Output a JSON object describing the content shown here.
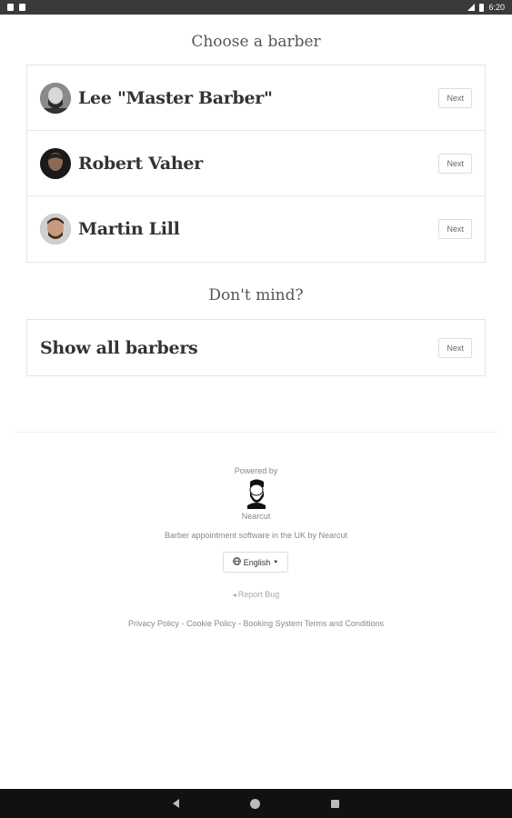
{
  "status_bar": {
    "time": "6:20"
  },
  "choose": {
    "heading": "Choose a barber",
    "barbers": [
      {
        "name": "Lee \"Master Barber\"",
        "next_label": "Next"
      },
      {
        "name": "Robert Vaher",
        "next_label": "Next"
      },
      {
        "name": "Martin Lill",
        "next_label": "Next"
      }
    ]
  },
  "dont_mind": {
    "heading": "Don't mind?",
    "option_label": "Show all barbers",
    "next_label": "Next"
  },
  "footer": {
    "powered_by": "Powered by",
    "brand": "Nearcut",
    "tagline": "Barber appointment software in the UK by Nearcut",
    "language": "English",
    "report_bug": "Report Bug",
    "links": "Privacy Policy - Cookie Policy - Booking System Terms and Conditions"
  }
}
